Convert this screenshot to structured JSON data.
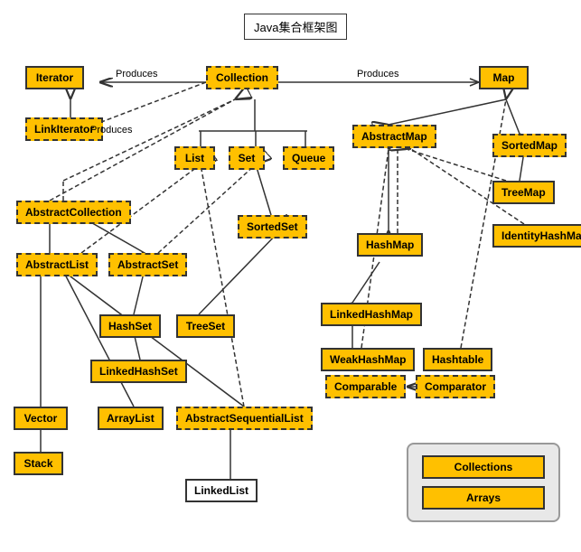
{
  "title": "Java集合框架图",
  "nodes": {
    "title": "Java集合框架图",
    "collection": "Collection",
    "iterator": "Iterator",
    "linkiterator": "LinkIterator",
    "abstractcollection": "AbstractCollection",
    "abstractlist": "AbstractList",
    "abstractset": "AbstractSet",
    "list": "List",
    "set": "Set",
    "queue": "Queue",
    "sortedset": "SortedSet",
    "hashset": "HashSet",
    "treeset": "TreeSet",
    "linkedhashset": "LinkedHashSet",
    "vector": "Vector",
    "stack": "Stack",
    "arraylist": "ArrayList",
    "abstractsequentiallist": "AbstractSequentialList",
    "linkedlist": "LinkedList",
    "map": "Map",
    "abstractmap": "AbstractMap",
    "sortedmap": "SortedMap",
    "hashmap": "HashMap",
    "linkedhashmap": "LinkedHashMap",
    "treemap": "TreeMap",
    "identityhashmap": "IdentityHashMap",
    "weakhashmap": "WeakHashMap",
    "hashtable": "Hashtable",
    "comparable": "Comparable",
    "comparator": "Comparator",
    "collections": "Collections",
    "arrays": "Arrays"
  },
  "labels": {
    "produces1": "Produces",
    "produces2": "Produces",
    "produces3": "Produces"
  }
}
